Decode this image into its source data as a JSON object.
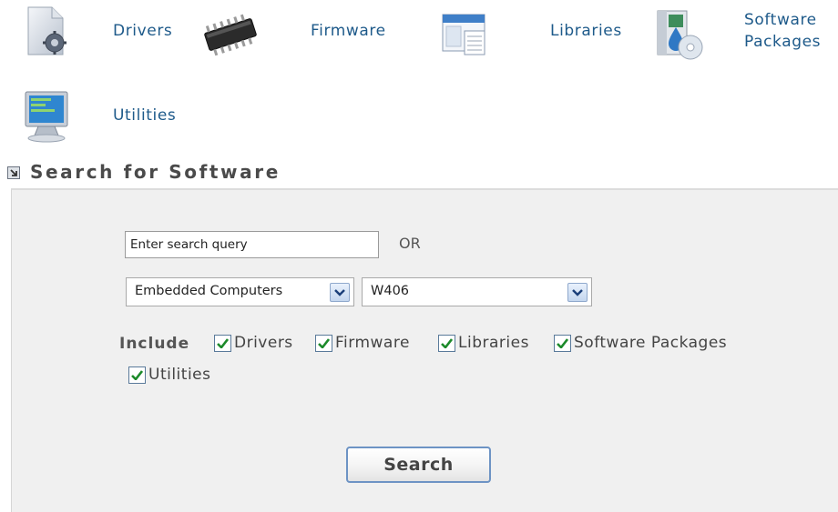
{
  "categories": {
    "drivers": "Drivers",
    "firmware": "Firmware",
    "libraries": "Libraries",
    "software_packages_line1": "Software",
    "software_packages_line2": "Packages",
    "utilities": "Utilities"
  },
  "section": {
    "title": "Search for Software"
  },
  "search": {
    "value": "Enter search query",
    "or_text": "OR"
  },
  "filters": {
    "product_family": "Embedded Computers",
    "model": "W406"
  },
  "include": {
    "label": "Include",
    "options": [
      {
        "label": "Drivers",
        "checked": true
      },
      {
        "label": "Firmware",
        "checked": true
      },
      {
        "label": "Libraries",
        "checked": true
      },
      {
        "label": "Software Packages",
        "checked": true
      },
      {
        "label": "Utilities",
        "checked": true
      }
    ]
  },
  "actions": {
    "search_label": "Search"
  },
  "colors": {
    "link": "#1e5a8a",
    "panel_bg": "#f0f0f0",
    "button_border": "#6d93c4"
  }
}
